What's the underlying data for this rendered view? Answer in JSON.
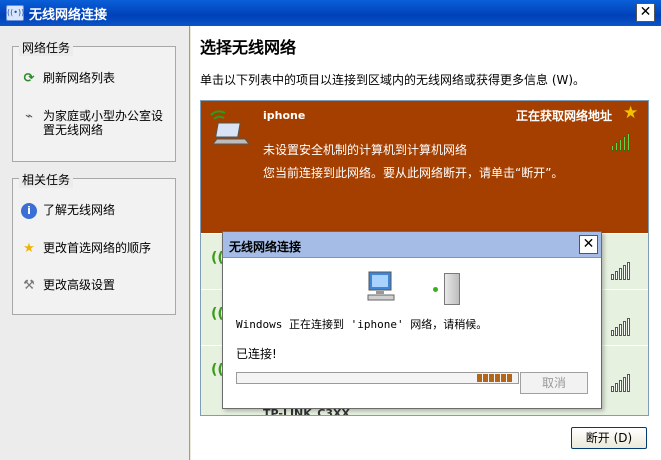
{
  "window": {
    "title": "无线网络连接",
    "icon_text": "((•))",
    "close_label": "✕"
  },
  "left": {
    "network_tasks": {
      "title": "网络任务",
      "items": [
        {
          "label": "刷新网络列表",
          "icon": "refresh-icon"
        },
        {
          "label": "为家庭或小型办公室设置无线网络",
          "icon": "setup-network-icon"
        }
      ]
    },
    "related_tasks": {
      "title": "相关任务",
      "items": [
        {
          "label": "了解无线网络",
          "icon": "info-icon"
        },
        {
          "label": "更改首选网络的顺序",
          "icon": "star-icon"
        },
        {
          "label": "更改高级设置",
          "icon": "tools-icon"
        }
      ]
    }
  },
  "main": {
    "heading": "选择无线网络",
    "instruction": "单击以下列表中的项目以连接到区域内的无线网络或获得更多信息 (W)。",
    "networks": {
      "selected": {
        "name": "iphone",
        "status": "正在获取网络地址",
        "security": "未设置安全机制的计算机到计算机网络",
        "connected_info": "您当前连接到此网络。要从此网络断开，请单击“断开”。",
        "signal_bars": 5
      },
      "partial_name": "TP-LINK_C3XX"
    },
    "disconnect_label": "断开 (D)"
  },
  "dialog": {
    "title": "无线网络连接",
    "message": "Windows 正在连接到 'iphone' 网络，请稍候。",
    "connected": "已连接!",
    "cancel_label": "取消",
    "close_label": "✕",
    "progress_blocks": 6
  },
  "colors": {
    "selected_bg": "#a43f00",
    "list_bg": "#e7f1e0",
    "title_bar": "#0041b8",
    "signal_green": "#66d34a"
  }
}
